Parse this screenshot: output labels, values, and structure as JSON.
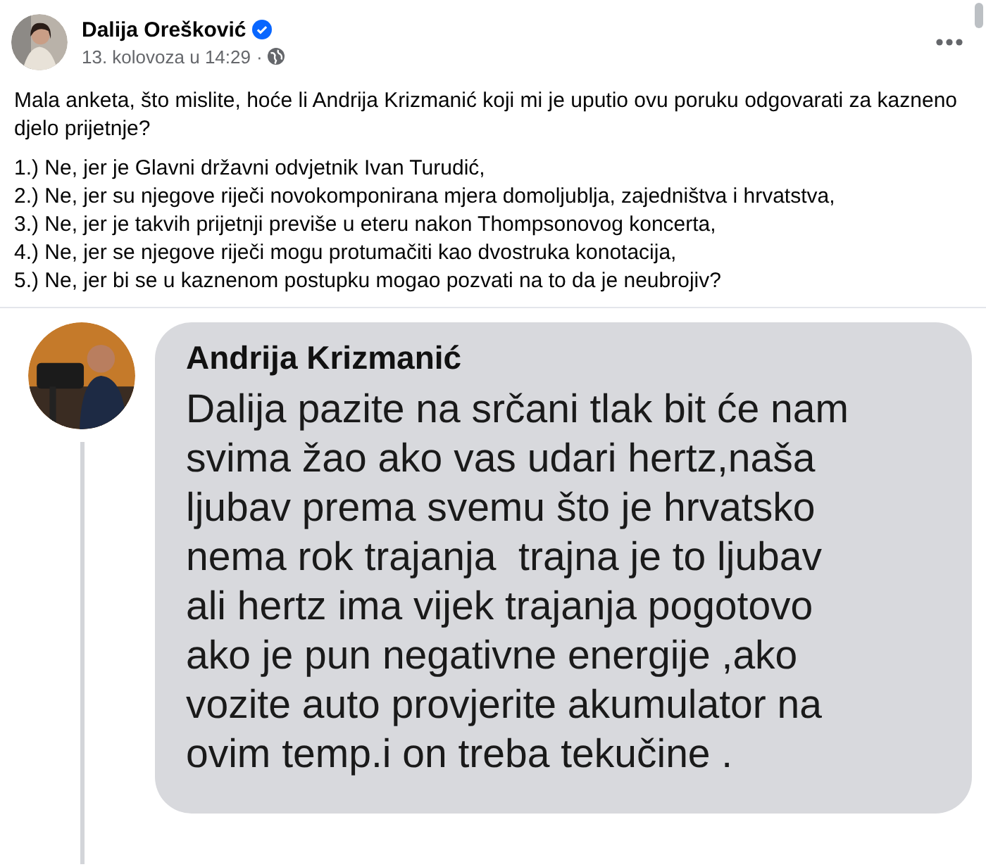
{
  "post": {
    "author": "Dalija Orešković",
    "verified": true,
    "timestamp": "13. kolovoza u 14:29",
    "separator": "·",
    "text": "Mala anketa, što mislite, hoće li Andrija Krizmanić koji mi je uputio ovu poruku odgovarati za kazneno djelo prijetnje?",
    "options": [
      "1.) Ne, jer je Glavni državni odvjetnik Ivan Turudić,",
      "2.) Ne, jer su njegove riječi novokomponirana mjera domoljublja, zajedništva i hrvatstva,",
      "3.) Ne, jer je takvih prijetnji previše u eteru nakon Thompsonovog koncerta,",
      "4.) Ne, jer se njegove riječi mogu protumačiti kao dvostruka konotacija,",
      "5.) Ne, jer bi se u kaznenom postupku mogao pozvati na to da je neubrojiv?"
    ]
  },
  "comment": {
    "author": "Andrija Krizmanić",
    "lines": [
      "Dalija pazite na srčani tlak bit će nam",
      "svima žao ako vas udari hertz,naša",
      "ljubav prema svemu što je hrvatsko",
      "nema rok trajanja  trajna je to ljubav",
      "ali hertz ima vijek trajanja pogotovo",
      "ako je pun negativne energije ,ako",
      "vozite auto provjerite akumulator na",
      "ovim temp.i on treba tekučine ."
    ]
  }
}
